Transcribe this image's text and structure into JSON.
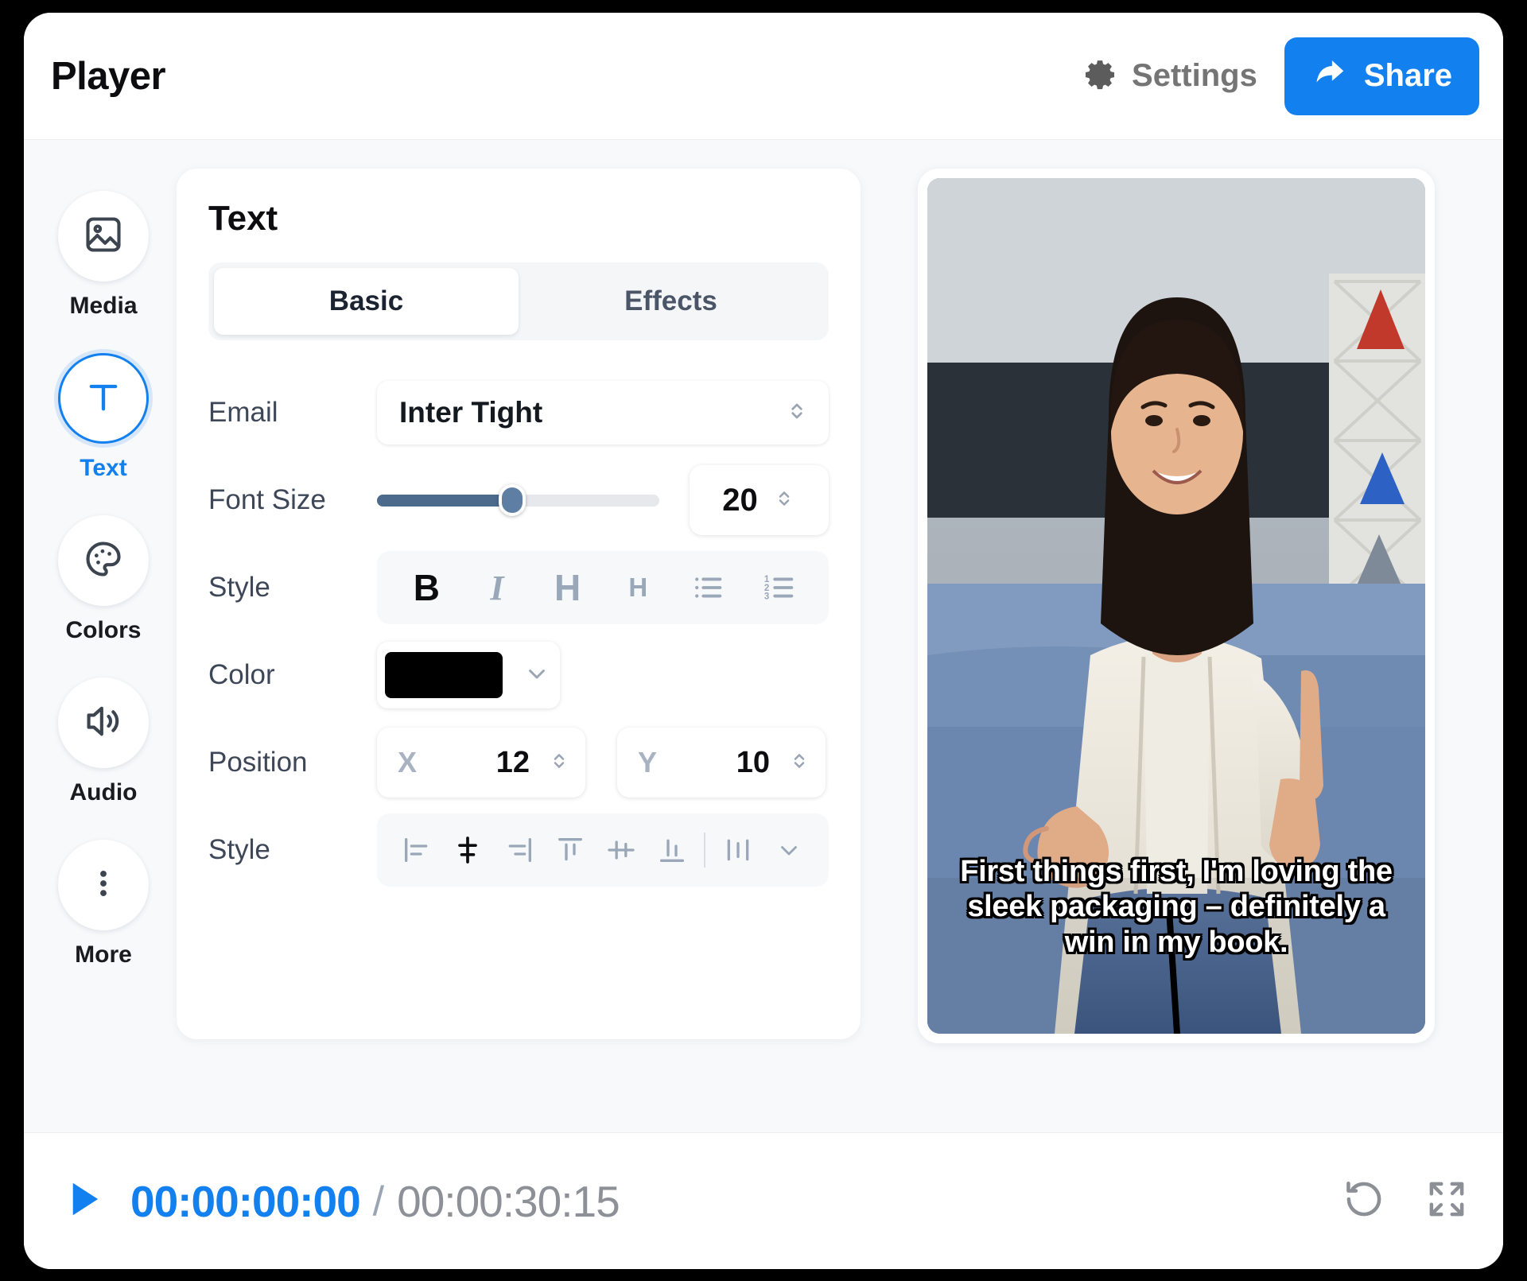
{
  "header": {
    "title": "Player",
    "settings_label": "Settings",
    "share_label": "Share",
    "accent_color": "#1380f0"
  },
  "sidebar": {
    "items": [
      {
        "label": "Media",
        "icon": "image-icon",
        "active": false
      },
      {
        "label": "Text",
        "icon": "text-t-icon",
        "active": true
      },
      {
        "label": "Colors",
        "icon": "palette-icon",
        "active": false
      },
      {
        "label": "Audio",
        "icon": "speaker-icon",
        "active": false
      },
      {
        "label": "More",
        "icon": "dots-vertical-icon",
        "active": false
      }
    ]
  },
  "panel": {
    "title": "Text",
    "tabs": [
      {
        "label": "Basic",
        "active": true
      },
      {
        "label": "Effects",
        "active": false
      }
    ],
    "font_row": {
      "label": "Email",
      "value": "Inter Tight",
      "caret_icon": "chevron-updown-icon"
    },
    "font_size_row": {
      "label": "Font Size",
      "value": "20",
      "slider_percent": 48,
      "slider_fill_color": "#4b6a8c",
      "stepper_icon": "chevron-updown-icon"
    },
    "text_style_row": {
      "label": "Style",
      "buttons": [
        {
          "name": "bold-button",
          "glyph": "B",
          "active": true
        },
        {
          "name": "italic-button",
          "glyph": "I",
          "active": false
        },
        {
          "name": "heading-large-button",
          "glyph": "H",
          "active": false
        },
        {
          "name": "heading-small-button",
          "glyph": "H",
          "active": false
        },
        {
          "name": "bulleted-list-button",
          "glyph": "",
          "active": false
        },
        {
          "name": "numbered-list-button",
          "glyph": "",
          "active": false
        }
      ]
    },
    "color_row": {
      "label": "Color",
      "value": "#000000",
      "caret_icon": "chevron-down-icon"
    },
    "position_row": {
      "label": "Position",
      "x_axis": "X",
      "x_value": "12",
      "y_axis": "Y",
      "y_value": "10",
      "stepper_icon": "chevron-updown-icon"
    },
    "align_style_row": {
      "label": "Style",
      "buttons": [
        {
          "name": "align-left-button",
          "active": false
        },
        {
          "name": "align-center-horizontal-button",
          "active": true
        },
        {
          "name": "align-right-button",
          "active": false
        },
        {
          "name": "align-top-button",
          "active": false
        },
        {
          "name": "align-middle-vertical-button",
          "active": false
        },
        {
          "name": "align-bottom-button",
          "active": false
        },
        {
          "name": "distribute-button",
          "active": false
        }
      ],
      "more_caret_icon": "chevron-down-icon"
    }
  },
  "preview": {
    "caption": "First things first, I'm loving the sleek packaging – definitely a win in my book."
  },
  "footer": {
    "play_icon": "play-icon",
    "current_time": "00:00:00:00",
    "separator": "/",
    "total_time": "00:00:30:15",
    "reset_icon": "rotate-ccw-icon",
    "fullscreen_icon": "expand-icon"
  }
}
